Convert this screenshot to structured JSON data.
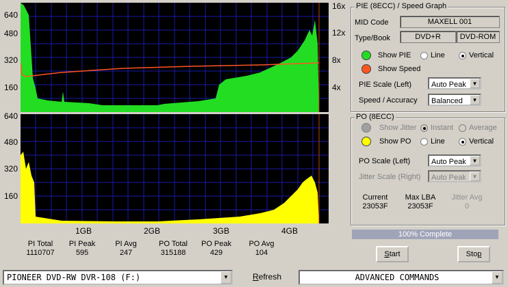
{
  "pie_axis": {
    "left_ticks": [
      "640",
      "480",
      "320",
      "160"
    ],
    "right_ticks": [
      "16x",
      "12x",
      "8x",
      "4x"
    ]
  },
  "po_axis": {
    "left_ticks": [
      "640",
      "480",
      "320",
      "160"
    ]
  },
  "x_ticks": [
    "1GB",
    "2GB",
    "3GB",
    "4GB"
  ],
  "stats": [
    {
      "label": "PI Total",
      "value": "1110707"
    },
    {
      "label": "PI Peak",
      "value": "595"
    },
    {
      "label": "PI Avg",
      "value": "247"
    },
    {
      "label": "PO Total",
      "value": "315188"
    },
    {
      "label": "PO Peak",
      "value": "429"
    },
    {
      "label": "PO Avg",
      "value": "104"
    }
  ],
  "pie_panel": {
    "title": "PIE (8ECC) / Speed Graph",
    "mid_label": "MID Code",
    "mid_value": "MAXELL 001",
    "type_label": "Type/Book",
    "type_value": "DVD+R",
    "book_value": "DVD-ROM",
    "show_pie": "Show PIE",
    "line": "Line",
    "vertical": "Vertical",
    "show_speed": "Show Speed",
    "scale_label": "PIE Scale (Left)",
    "scale_value": "Auto Peak",
    "speed_label": "Speed / Accuracy",
    "speed_value": "Balanced",
    "pie_color": "#22dd22",
    "speed_color": "#ff5522"
  },
  "po_panel": {
    "title": "PO (8ECC)",
    "show_jitter": "Show Jitter",
    "instant": "Instant",
    "average": "Average",
    "show_po": "Show PO",
    "line": "Line",
    "vertical": "Vertical",
    "scale_label": "PO Scale (Left)",
    "scale_value": "Auto Peak",
    "jitter_label": "Jitter Scale (Right)",
    "jitter_value": "Auto Peak",
    "current_label": "Current",
    "current_value": "23053F",
    "maxlba_label": "Max LBA",
    "maxlba_value": "23053F",
    "jitter_avg_label": "Jitter Avg",
    "jitter_avg_value": "0",
    "po_color": "#ffff00"
  },
  "progress": {
    "text": "100% Complete",
    "fraction": 1.0
  },
  "buttons": {
    "start": "Start",
    "stop": "Stop",
    "refresh": "Refresh"
  },
  "drive": {
    "value": "PIONEER DVD-RW  DVR-108  (F:)"
  },
  "commands": {
    "value": "ADVANCED COMMANDS"
  }
}
